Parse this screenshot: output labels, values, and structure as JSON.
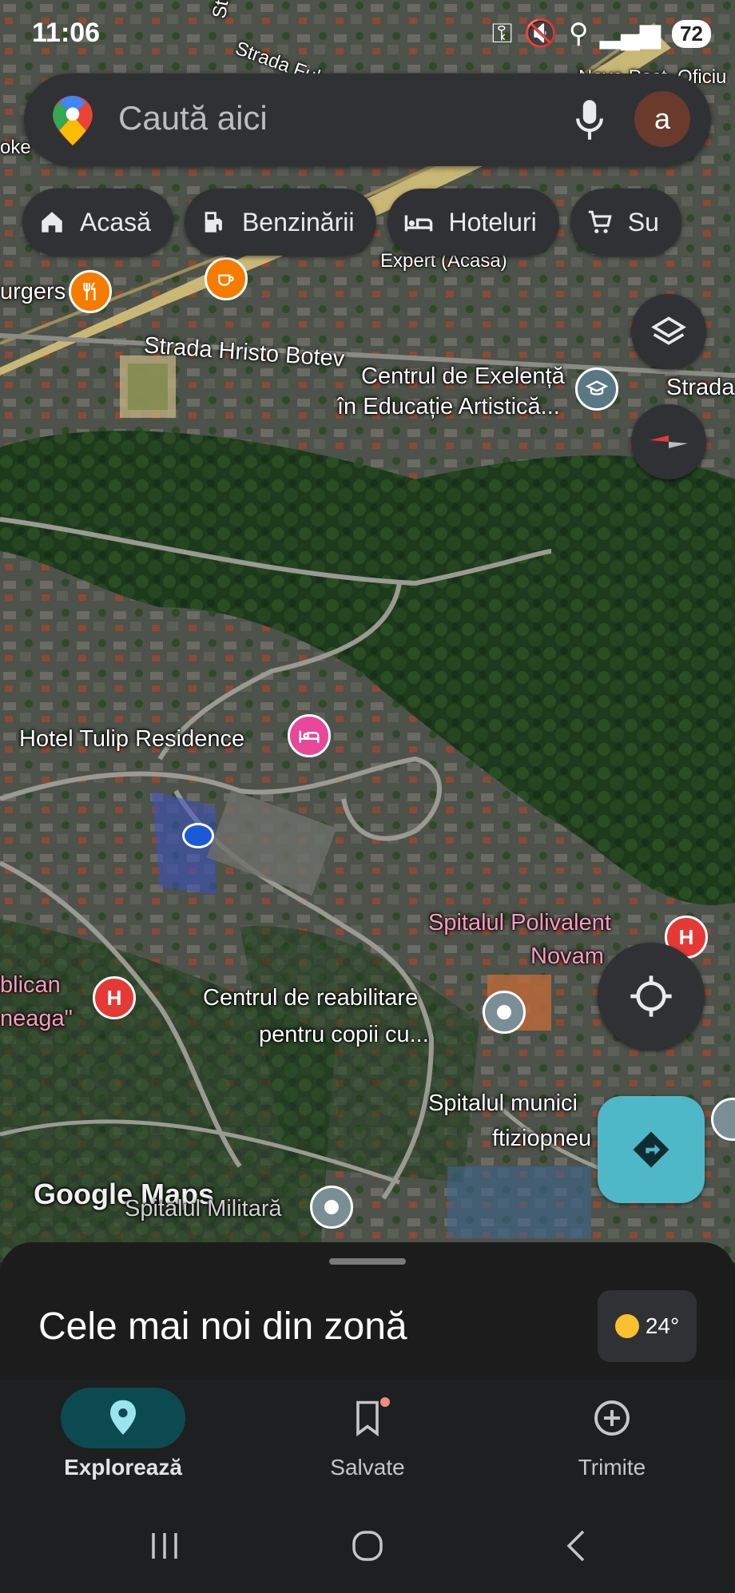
{
  "status_bar": {
    "time": "11:06",
    "battery": "72"
  },
  "search": {
    "placeholder": "Caută aici",
    "avatar_letter": "a"
  },
  "chips": [
    {
      "label": "Acasă",
      "icon": "home-icon"
    },
    {
      "label": "Benzinării",
      "icon": "gas-station-icon"
    },
    {
      "label": "Hoteluri",
      "icon": "bed-icon"
    },
    {
      "label": "Su",
      "icon": "shopping-cart-icon"
    }
  ],
  "map": {
    "labels": {
      "strada_hristo_botev": "Strada Hristo Botev",
      "strada_right": "Strada",
      "centru_exelenta_1": "Centrul de Exelență",
      "centru_exelenta_2": "în Educație Artistică...",
      "hotel_tulip": "Hotel Tulip Residence",
      "spital_polivalent_1": "Spitalul Polivalent",
      "spital_polivalent_2": "Novam",
      "centrul_reabilitare_1": "Centrul de reabilitare",
      "centrul_reabilitare_2": "pentru copii cu...",
      "spital_municipal_1": "Spitalul munici",
      "spital_municipal_2": "ftiziopneu",
      "spitalul_militar": "Spitalul Militară",
      "republican_1": "blican",
      "republican_2": "neaga\"",
      "urgers": "urgers",
      "oke": "oke",
      "expert": "Expert (Acasă)",
      "nova_post": "Nova Post. Oficiu",
      "strada_vertical": "Strada N",
      "strada_fulg": "Strada Ful",
      "google_maps": "Google Maps"
    }
  },
  "sheet": {
    "title": "Cele mai noi din zonă",
    "temperature": "24°"
  },
  "bottom_nav": [
    {
      "label": "Explorează",
      "active": true
    },
    {
      "label": "Salvate",
      "active": false
    },
    {
      "label": "Trimite",
      "active": false
    }
  ],
  "colors": {
    "accent": "#0c4a52",
    "directions_button": "#4fb8c8",
    "hospital_red": "#e53935",
    "hotel_pink": "#e8479a",
    "cafe_orange": "#f57c00"
  }
}
